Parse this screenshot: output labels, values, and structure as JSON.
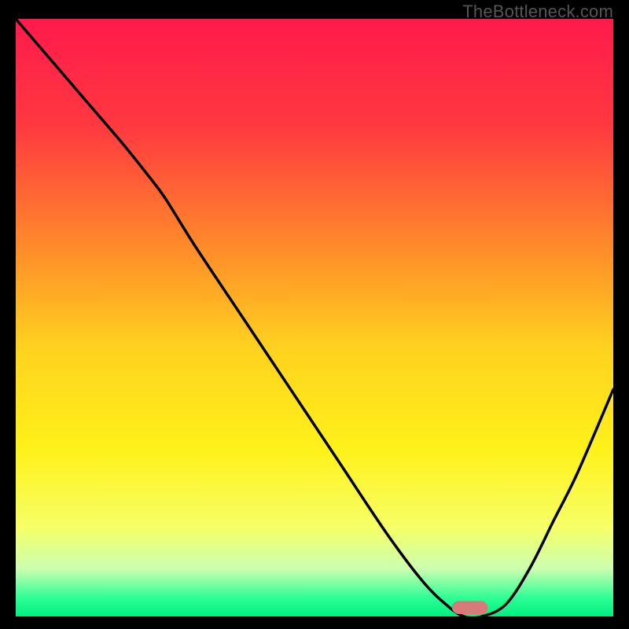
{
  "watermark": "TheBottleneck.com",
  "chart_data": {
    "type": "line",
    "title": "",
    "xlabel": "",
    "ylabel": "",
    "xlim": [
      0,
      100
    ],
    "ylim": [
      0,
      100
    ],
    "grid": false,
    "background_gradient": {
      "stops": [
        {
          "pct": 0,
          "color": "#ff1a4b"
        },
        {
          "pct": 18,
          "color": "#ff3940"
        },
        {
          "pct": 38,
          "color": "#ff8a2a"
        },
        {
          "pct": 55,
          "color": "#ffd21f"
        },
        {
          "pct": 72,
          "color": "#fff11a"
        },
        {
          "pct": 85,
          "color": "#f6ff66"
        },
        {
          "pct": 92,
          "color": "#ccffb0"
        },
        {
          "pct": 97,
          "color": "#2aff94"
        },
        {
          "pct": 100,
          "color": "#00ef82"
        }
      ]
    },
    "series": [
      {
        "name": "curve",
        "color": "#000000",
        "x": [
          0,
          6,
          12,
          18,
          22,
          25,
          30,
          38,
          46,
          54,
          62,
          68,
          72,
          75,
          78,
          82,
          86,
          90,
          94,
          100
        ],
        "y": [
          100,
          93,
          86,
          79,
          74,
          70,
          62,
          50,
          38,
          26,
          14,
          6,
          2,
          0,
          0,
          2,
          8,
          16,
          24,
          38
        ]
      }
    ],
    "marker": {
      "x": 76,
      "y": 1.5,
      "width": 6,
      "height": 2.2,
      "rx": 1.1,
      "color": "#d97a7a"
    }
  }
}
